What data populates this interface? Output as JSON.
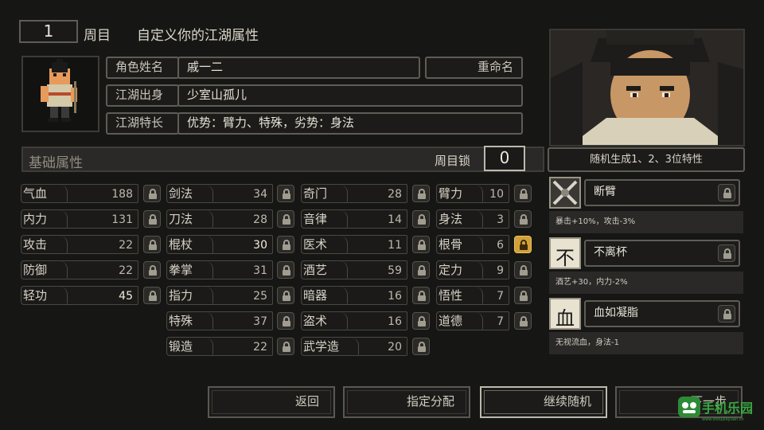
{
  "header": {
    "round_number": "1",
    "round_label": "周目",
    "title": "自定义你的江湖属性"
  },
  "character": {
    "name_label": "角色姓名",
    "name_value": "戚一二",
    "rename_button": "重命名",
    "origin_label": "江湖出身",
    "origin_value": "少室山孤儿",
    "specialty_label": "江湖特长",
    "specialty_value": "优势：臂力、特殊，劣势：身法"
  },
  "base_attributes": {
    "title": "基础属性",
    "lock_label": "周目锁",
    "lock_count": "0"
  },
  "stats": {
    "col1": [
      {
        "name": "气血",
        "value": "188"
      },
      {
        "name": "内力",
        "value": "131"
      },
      {
        "name": "攻击",
        "value": "22"
      },
      {
        "name": "防御",
        "value": "22"
      },
      {
        "name": "轻功",
        "value": "45"
      }
    ],
    "col2": [
      {
        "name": "剑法",
        "value": "34"
      },
      {
        "name": "刀法",
        "value": "28"
      },
      {
        "name": "棍杖",
        "value": "30"
      },
      {
        "name": "拳掌",
        "value": "31"
      },
      {
        "name": "指力",
        "value": "25"
      },
      {
        "name": "特殊",
        "value": "37"
      },
      {
        "name": "锻造",
        "value": "22"
      }
    ],
    "col3": [
      {
        "name": "奇门",
        "value": "28"
      },
      {
        "name": "音律",
        "value": "14"
      },
      {
        "name": "医术",
        "value": "11"
      },
      {
        "name": "酒艺",
        "value": "59"
      },
      {
        "name": "暗器",
        "value": "16"
      },
      {
        "name": "盗术",
        "value": "16"
      },
      {
        "name": "武学造",
        "value": "20"
      }
    ],
    "col4": [
      {
        "name": "臂力",
        "value": "10"
      },
      {
        "name": "身法",
        "value": "3"
      },
      {
        "name": "根骨",
        "value": "6"
      },
      {
        "name": "定力",
        "value": "9"
      },
      {
        "name": "悟性",
        "value": "7"
      },
      {
        "name": "道德",
        "value": "7"
      }
    ]
  },
  "traits": {
    "header": "随机生成1、2、3位特性",
    "items": [
      {
        "icon_char": "",
        "icon_name": "broken-arm-icon",
        "name": "断臂",
        "desc": "暴击+10%，攻击-3%"
      },
      {
        "icon_char": "不",
        "icon_name": "char-bu-icon",
        "name": "不离杯",
        "desc": "酒艺+30，内力-2%"
      },
      {
        "icon_char": "血",
        "icon_name": "char-xue-icon",
        "name": "血如凝脂",
        "desc": "无视流血，身法-1"
      }
    ]
  },
  "buttons": {
    "back": "返回",
    "assign": "指定分配",
    "reroll": "继续随机",
    "next": "下一步"
  },
  "watermark": {
    "text": "手机乐园",
    "sub": "www.shoujileyuan.cn"
  },
  "colors": {
    "gold_lock": "#d1a03a",
    "background": "#161614",
    "watermark_green": "#3aa843"
  }
}
